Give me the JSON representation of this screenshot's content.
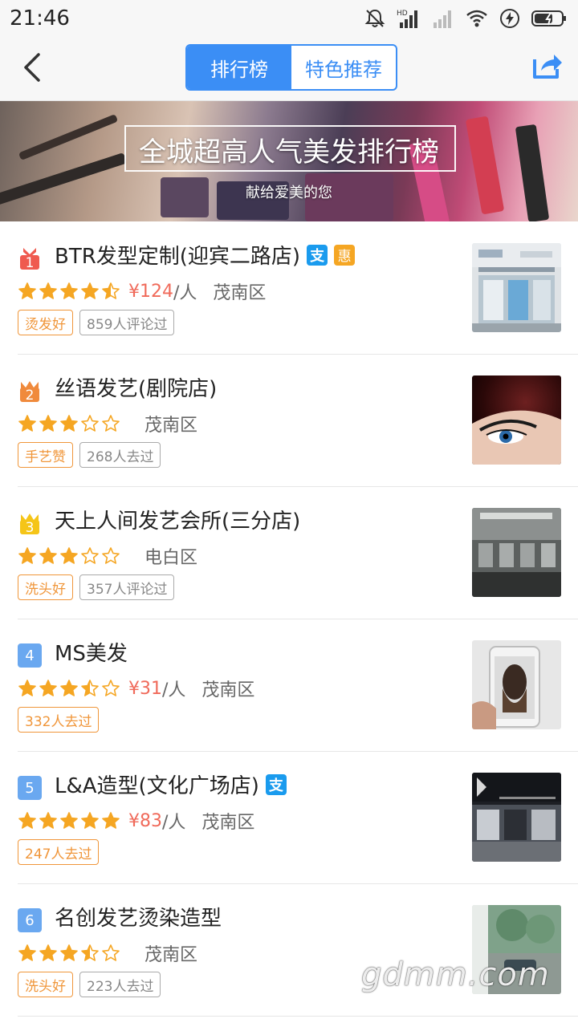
{
  "status_bar": {
    "time": "21:46",
    "network_label": "HD"
  },
  "nav": {
    "tabs": [
      {
        "label": "排行榜",
        "active": true
      },
      {
        "label": "特色推荐",
        "active": false
      }
    ],
    "back_icon": "chevron-left-icon",
    "share_icon": "share-icon"
  },
  "banner": {
    "title": "全城超高人气美发排行榜",
    "subtitle": "献给爱美的您"
  },
  "colors": {
    "accent": "#3b8ef5",
    "price": "#f06a5a",
    "star": "#f5a623",
    "tag_orange": "#f0963a"
  },
  "shops": [
    {
      "rank": "1",
      "name": "BTR发型定制(迎宾二路店)",
      "alipay": true,
      "hui": true,
      "rating": 4.5,
      "price": "¥124",
      "per": "/人",
      "district": "茂南区",
      "tags": [
        {
          "text": "烫发好",
          "style": "orange"
        },
        {
          "text": "859人评论过",
          "style": "gray"
        }
      ]
    },
    {
      "rank": "2",
      "name": "丝语发艺(剧院店)",
      "alipay": false,
      "hui": false,
      "rating": 3,
      "price": "",
      "per": "",
      "district": "茂南区",
      "tags": [
        {
          "text": "手艺赞",
          "style": "orange"
        },
        {
          "text": "268人去过",
          "style": "gray"
        }
      ]
    },
    {
      "rank": "3",
      "name": "天上人间发艺会所(三分店)",
      "alipay": false,
      "hui": false,
      "rating": 3,
      "price": "",
      "per": "",
      "district": "电白区",
      "tags": [
        {
          "text": "洗头好",
          "style": "orange"
        },
        {
          "text": "357人评论过",
          "style": "gray"
        }
      ]
    },
    {
      "rank": "4",
      "name": "MS美发",
      "alipay": false,
      "hui": false,
      "rating": 3.5,
      "price": "¥31",
      "per": "/人",
      "district": "茂南区",
      "tags": [
        {
          "text": "332人去过",
          "style": "orange"
        }
      ]
    },
    {
      "rank": "5",
      "name": "L&A造型(文化广场店)",
      "alipay": true,
      "hui": false,
      "rating": 5,
      "price": "¥83",
      "per": "/人",
      "district": "茂南区",
      "tags": [
        {
          "text": "247人去过",
          "style": "orange"
        }
      ]
    },
    {
      "rank": "6",
      "name": "名创发艺烫染造型",
      "alipay": false,
      "hui": false,
      "rating": 3.5,
      "price": "",
      "per": "",
      "district": "茂南区",
      "tags": [
        {
          "text": "洗头好",
          "style": "orange"
        },
        {
          "text": "223人去过",
          "style": "gray"
        }
      ]
    }
  ],
  "badges": {
    "alipay_glyph": "支",
    "hui_glyph": "惠"
  },
  "watermark": "gdmm.com"
}
